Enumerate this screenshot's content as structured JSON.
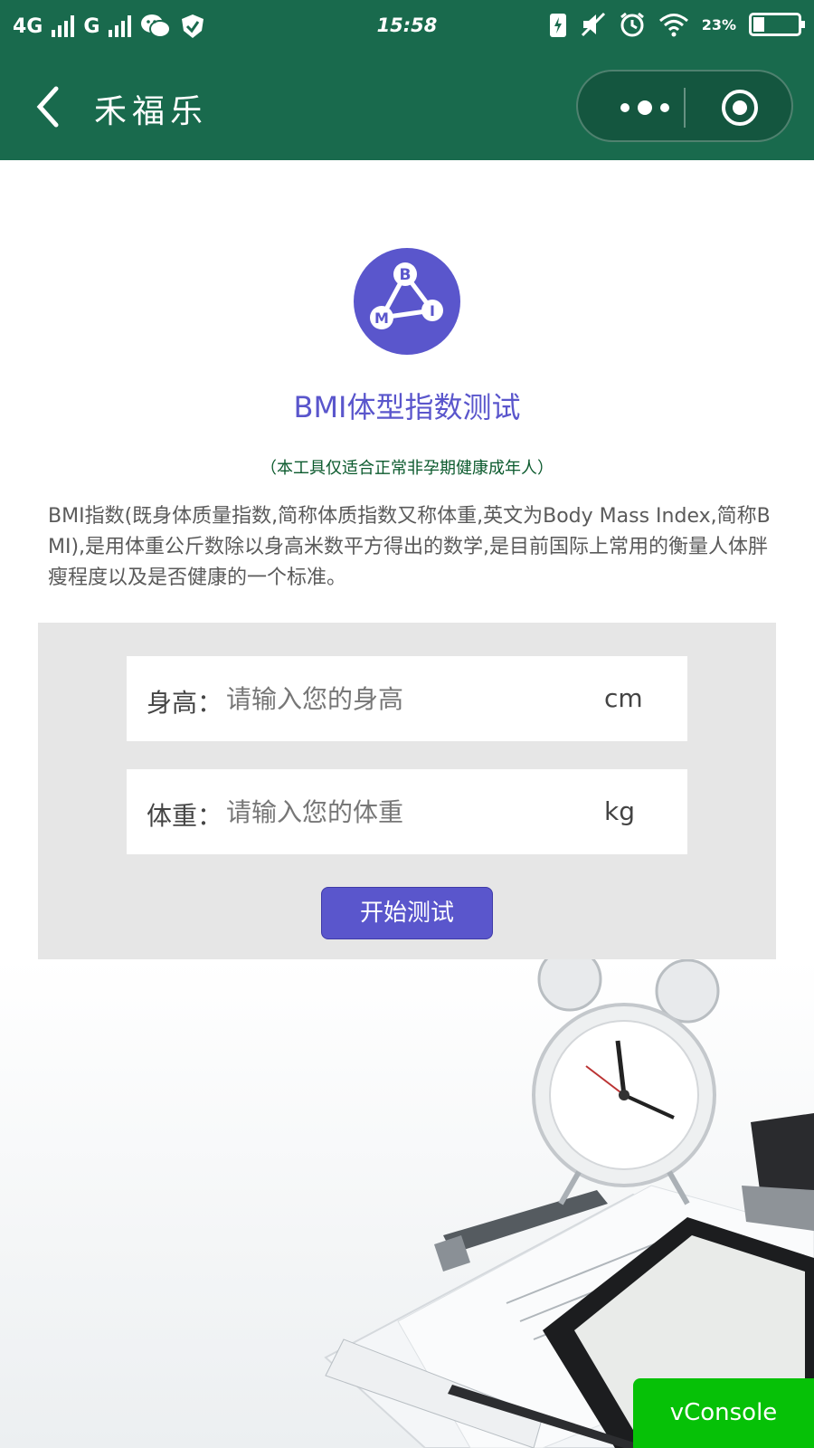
{
  "status_bar": {
    "network_1": "4G",
    "network_2": "G",
    "time": "15:58",
    "battery_percent": "23"
  },
  "nav": {
    "title": "禾福乐"
  },
  "icons": {
    "back": "chevron-left-icon",
    "more": "more-dots-icon",
    "close": "target-circle-icon",
    "logo": "bmi-molecule-icon"
  },
  "logo": {
    "letters": [
      "B",
      "M",
      "I"
    ]
  },
  "page": {
    "title": "BMI体型指数测试",
    "subtitle": "（本工具仅适合正常非孕期健康成年人）",
    "description": "BMI指数(既身体质量指数,简称体质指数又称体重,英文为Body Mass Index,简称BMI),是用体重公斤数除以身高米数平方得出的数学,是目前国际上常用的衡量人体胖瘦程度以及是否健康的一个标准。"
  },
  "form": {
    "height": {
      "label": "身高：",
      "placeholder": "请输入您的身高",
      "unit": "cm"
    },
    "weight": {
      "label": "体重：",
      "placeholder": "请输入您的体重",
      "unit": "kg"
    },
    "submit_label": "开始测试"
  },
  "vconsole_label": "vConsole",
  "colors": {
    "header_green": "#196a4d",
    "accent_purple": "#5a56cc",
    "subtitle_green": "#0b5a2d",
    "form_bg": "#e6e6e6",
    "vconsole_green": "#06c107"
  }
}
